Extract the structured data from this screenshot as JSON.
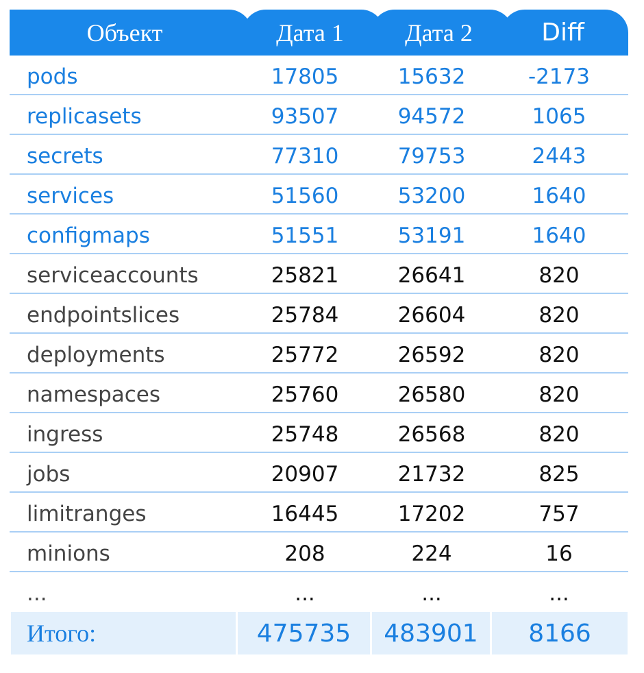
{
  "header": {
    "col_object": "Объект",
    "col_date1": "Дата 1",
    "col_date2": "Дата 2",
    "col_diff": "Diff"
  },
  "rows": [
    {
      "name": "pods",
      "date1": "17805",
      "date2": "15632",
      "diff": "-2173",
      "highlight": true
    },
    {
      "name": "replicasets",
      "date1": "93507",
      "date2": "94572",
      "diff": "1065",
      "highlight": true
    },
    {
      "name": "secrets",
      "date1": "77310",
      "date2": "79753",
      "diff": "2443",
      "highlight": true
    },
    {
      "name": "services",
      "date1": "51560",
      "date2": "53200",
      "diff": "1640",
      "highlight": true
    },
    {
      "name": "configmaps",
      "date1": "51551",
      "date2": "53191",
      "diff": "1640",
      "highlight": true
    },
    {
      "name": "serviceaccounts",
      "date1": "25821",
      "date2": "26641",
      "diff": "820",
      "highlight": false
    },
    {
      "name": "endpointslices",
      "date1": "25784",
      "date2": "26604",
      "diff": "820",
      "highlight": false
    },
    {
      "name": "deployments",
      "date1": "25772",
      "date2": "26592",
      "diff": "820",
      "highlight": false
    },
    {
      "name": "namespaces",
      "date1": "25760",
      "date2": "26580",
      "diff": "820",
      "highlight": false
    },
    {
      "name": "ingress",
      "date1": "25748",
      "date2": "26568",
      "diff": "820",
      "highlight": false
    },
    {
      "name": "jobs",
      "date1": "20907",
      "date2": "21732",
      "diff": "825",
      "highlight": false
    },
    {
      "name": "limitranges",
      "date1": "16445",
      "date2": "17202",
      "diff": "757",
      "highlight": false
    },
    {
      "name": "minions",
      "date1": "208",
      "date2": "224",
      "diff": "16",
      "highlight": false
    },
    {
      "name": "...",
      "date1": "...",
      "date2": "...",
      "diff": "...",
      "highlight": false
    }
  ],
  "total": {
    "label": "Итого:",
    "date1": "475735",
    "date2": "483901",
    "diff": "8166"
  },
  "colors": {
    "header_bg": "#1a88ea",
    "highlight_text": "#1a7fe0",
    "row_divider": "#a9cff5",
    "total_bg": "#e3f0fc"
  }
}
